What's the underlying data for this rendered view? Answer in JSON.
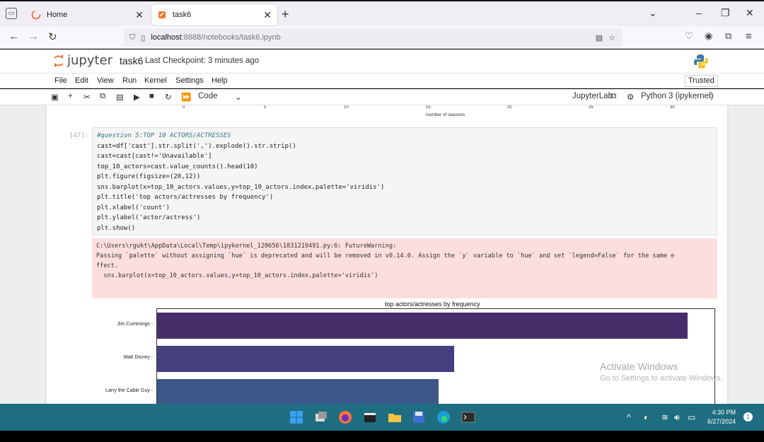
{
  "browser": {
    "tabs": [
      {
        "label": "Home",
        "active": false,
        "icon": "firefox-loading-icon"
      },
      {
        "label": "task6",
        "active": true,
        "icon": "jupyter-notebook-icon"
      }
    ],
    "url_host": "localhost",
    "url_path": ":8888/notebooks/task6.ipynb"
  },
  "jupyter": {
    "logo_text": "jupyter",
    "notebook_name": "task6",
    "checkpoint": "Last Checkpoint: 3 minutes ago",
    "menu": [
      "File",
      "Edit",
      "View",
      "Run",
      "Kernel",
      "Settings",
      "Help"
    ],
    "trusted": "Trusted",
    "cell_type": "Code",
    "jupyterlab_label": "JupyterLab",
    "kernel": "Python 3 (ipykernel)"
  },
  "prev_chart": {
    "x_ticks": [
      "0",
      "5",
      "10",
      "15",
      "20",
      "25",
      "30"
    ],
    "x_label": "number of seasons"
  },
  "cell": {
    "prompt": "[47]:",
    "code": [
      "#question 5:TOP 10 ACTORS/ACTRESSES",
      "cast=df['cast'].str.split(',').explode().str.strip()",
      "cast=cast[cast!='Unavailable']",
      "top_10_actors=cast.value_counts().head(10)",
      "plt.figure(figsize=(20,12))",
      "sns.barplot(x=top_10_actors.values,y=top_10_actors.index,palette='viridis')",
      "plt.title('top actors/actresses by frequency')",
      "plt.xlabel('count')",
      "plt.ylabel('actor/actress')",
      "plt.show()"
    ],
    "warning": [
      "C:\\Users\\rgukt\\AppData\\Local\\Temp\\ipykernel_120656\\1831219491.py:6: FutureWarning:",
      "",
      "Passing `palette` without assigning `hue` is deprecated and will be removed in v0.14.0. Assign the `y` variable to `hue` and set `legend=False` for the same e",
      "ffect.",
      "",
      "  sns.barplot(x=top_10_actors.values,y=top_10_actors.index,palette='viridis')"
    ]
  },
  "chart_data": {
    "type": "bar",
    "orientation": "horizontal",
    "title": "top actors/actresses by frequency",
    "categories": [
      "Jim Cummings",
      "Walt Disney",
      "Larry the Cable Guy"
    ],
    "values": [
      100,
      56,
      53
    ],
    "value_scale": "relative (x-axis not visible)",
    "colors": [
      "#482d6b",
      "#45407f",
      "#3e5789"
    ]
  },
  "watermark": {
    "line1": "Activate Windows",
    "line2": "Go to Settings to activate Windows."
  },
  "taskbar": {
    "time": "4:30 PM",
    "date": "6/27/2024",
    "notification_count": "1"
  }
}
